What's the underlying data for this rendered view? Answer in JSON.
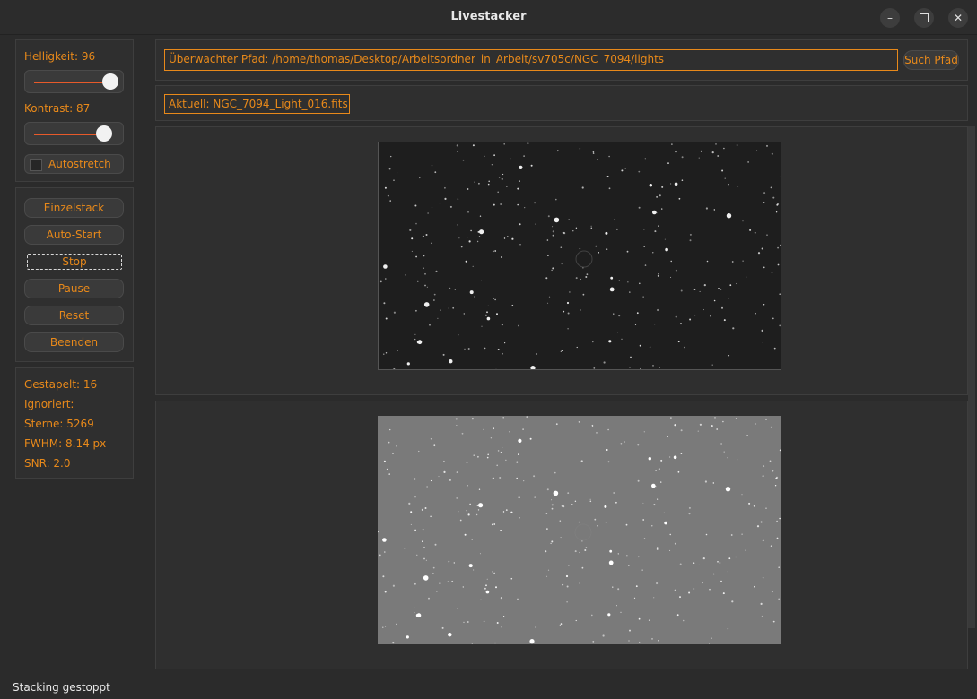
{
  "window": {
    "title": "Livestacker",
    "min_icon": "minimize-icon",
    "max_icon": "maximize-icon",
    "close_icon": "close-icon",
    "close_glyph": "✕",
    "min_glyph": "–"
  },
  "sidebar": {
    "brightness_label": "Helligkeit: 96",
    "brightness_value": 96,
    "contrast_label": "Kontrast: 87",
    "contrast_value": 87,
    "autostretch_label": "Autostretch",
    "autostretch_checked": false,
    "buttons": {
      "single_stack": "Einzelstack",
      "auto_start": "Auto-Start",
      "stop": "Stop",
      "pause": "Pause",
      "reset": "Reset",
      "quit": "Beenden"
    },
    "stats": {
      "stacked": "Gestapelt: 16",
      "ignored": "Ignoriert:",
      "stars": "Sterne: 5269",
      "fwhm": "FWHM: 8.14 px",
      "snr": "SNR: 2.0"
    }
  },
  "main": {
    "path_value": "Überwachter Pfad: /home/thomas/Desktop/Arbeitsordner_in_Arbeit/sv705c/NGC_7094/lights",
    "search_button": "Such Pfad",
    "current_file": "Aktuell: NGC_7094_Light_016.fits"
  },
  "status": {
    "text": "Stacking gestoppt"
  },
  "colors": {
    "accent": "#e8891a",
    "slider_track": "#e85a2a",
    "background": "#2b2b2b"
  }
}
